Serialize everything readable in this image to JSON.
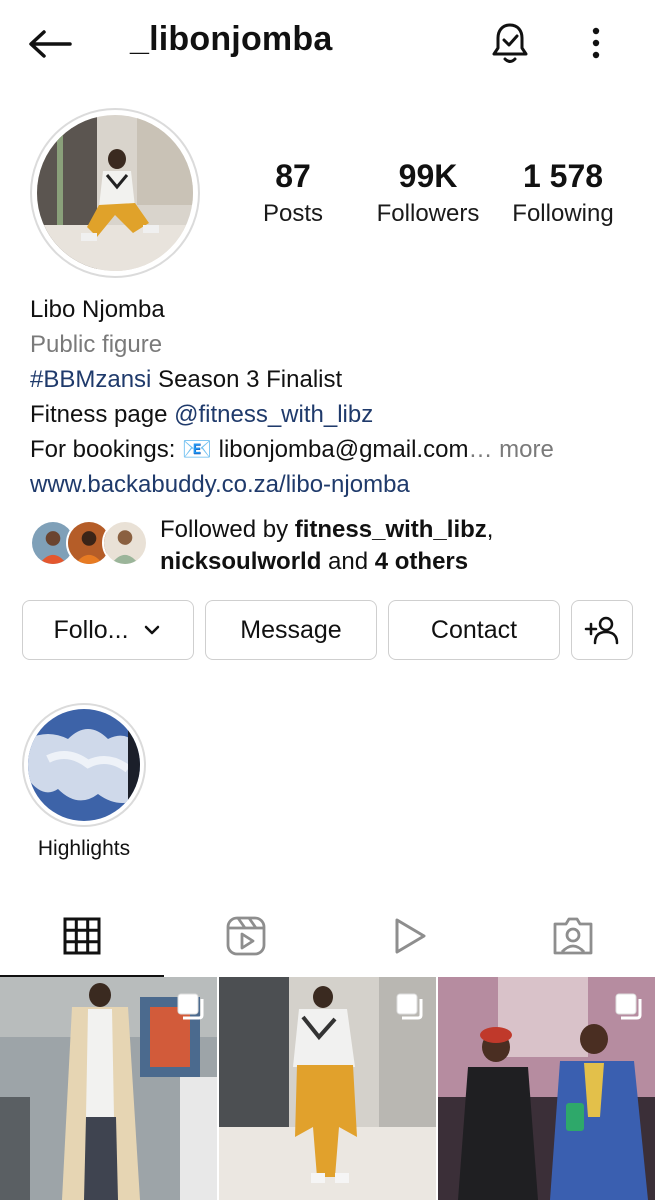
{
  "header": {
    "username": "_libonjomba",
    "back_icon": "arrow-left-icon",
    "bell_icon": "bell-check-icon",
    "more_icon": "vertical-dots-icon"
  },
  "profile": {
    "stats": [
      {
        "value": "87",
        "label": "Posts"
      },
      {
        "value": "99K",
        "label": "Followers"
      },
      {
        "value": "1 578",
        "label": "Following"
      }
    ],
    "name": "Libo Njomba",
    "category": "Public figure",
    "bio": {
      "line1_tag": "#BBMzansi",
      "line1_rest": " Season 3 Finalist",
      "line2_prefix": "Fitness page ",
      "line2_mention": "@fitness_with_libz",
      "line3_prefix": "For bookings: ",
      "line3_emoji": "📧",
      "line3_email": " libonjomba@gmail.com",
      "line3_more": "… more",
      "website": "www.backabuddy.co.za/libo-njomba"
    },
    "followed_by": {
      "prefix": "Followed by ",
      "user1": "fitness_with_libz",
      "sep": ",",
      "user2": "nicksoulworld",
      "and": " and ",
      "others": "4 others"
    }
  },
  "actions": {
    "follow": "Follo...",
    "message": "Message",
    "contact": "Contact",
    "add_user_icon": "add-person-icon"
  },
  "highlights": [
    {
      "label": "Highlights"
    }
  ],
  "tabs": [
    {
      "name": "grid-icon",
      "active": true
    },
    {
      "name": "reels-icon",
      "active": false
    },
    {
      "name": "video-play-icon",
      "active": false
    },
    {
      "name": "tagged-icon",
      "active": false
    }
  ],
  "colors": {
    "link": "#1f3a6b",
    "muted": "#7a7a7a",
    "border": "#cfcfcf"
  }
}
